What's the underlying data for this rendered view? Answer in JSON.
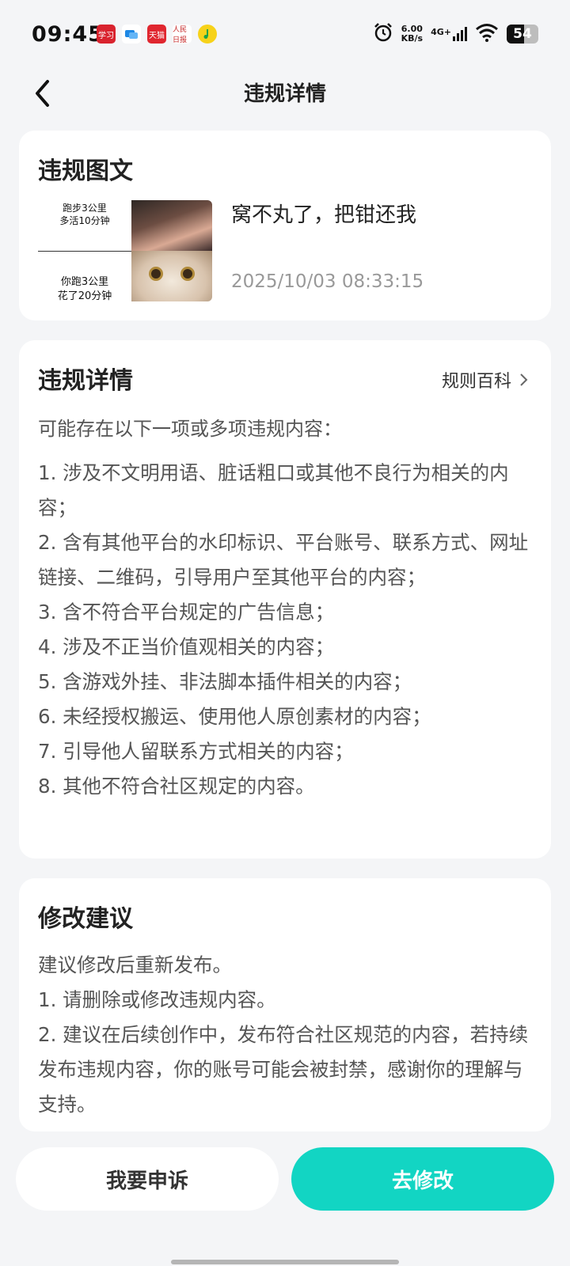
{
  "status": {
    "time": "09:45",
    "net_speed_value": "6.00",
    "net_speed_unit": "KB/s",
    "network": "4G+",
    "battery": "54",
    "battery_level": 0.54,
    "notif_icons": [
      "study-app-icon",
      "message-app-icon",
      "tmall-app-icon",
      "peoples-daily-app-icon",
      "qq-music-app-icon"
    ],
    "notif_labels": [
      "学习",
      "",
      "天猫",
      "人民日报",
      ""
    ]
  },
  "header": {
    "title": "违规详情"
  },
  "post_card": {
    "heading": "违规图文",
    "thumb_lines_top": [
      "跑步3公里",
      "多活10分钟"
    ],
    "thumb_lines_bottom": [
      "你跑3公里",
      "花了20分钟"
    ],
    "post_title": "窝不丸了，把钳还我",
    "post_time": "2025/10/03 08:33:15"
  },
  "details_card": {
    "heading": "违规详情",
    "rules_link": "规则百科",
    "intro": "可能存在以下一项或多项违规内容：",
    "items": [
      "1. 涉及不文明用语、脏话粗口或其他不良行为相关的内容；",
      "2. 含有其他平台的水印标识、平台账号、联系方式、网址链接、二维码，引导用户至其他平台的内容；",
      "3. 含不符合平台规定的广告信息；",
      "4. 涉及不正当价值观相关的内容；",
      "5. 含游戏外挂、非法脚本插件相关的内容；",
      "6. 未经授权搬运、使用他人原创素材的内容；",
      "7. 引导他人留联系方式相关的内容；",
      "8. 其他不符合社区规定的内容。"
    ]
  },
  "suggestion_card": {
    "heading": "修改建议",
    "lines": [
      "建议修改后重新发布。",
      "1. 请删除或修改违规内容。",
      "2. 建议在后续创作中，发布符合社区规范的内容，若持续发布违规内容，你的账号可能会被封禁，感谢你的理解与支持。"
    ]
  },
  "actions": {
    "appeal": "我要申诉",
    "modify": "去修改"
  },
  "colors": {
    "accent": "#12d5c3",
    "background": "#f4f5f7"
  }
}
